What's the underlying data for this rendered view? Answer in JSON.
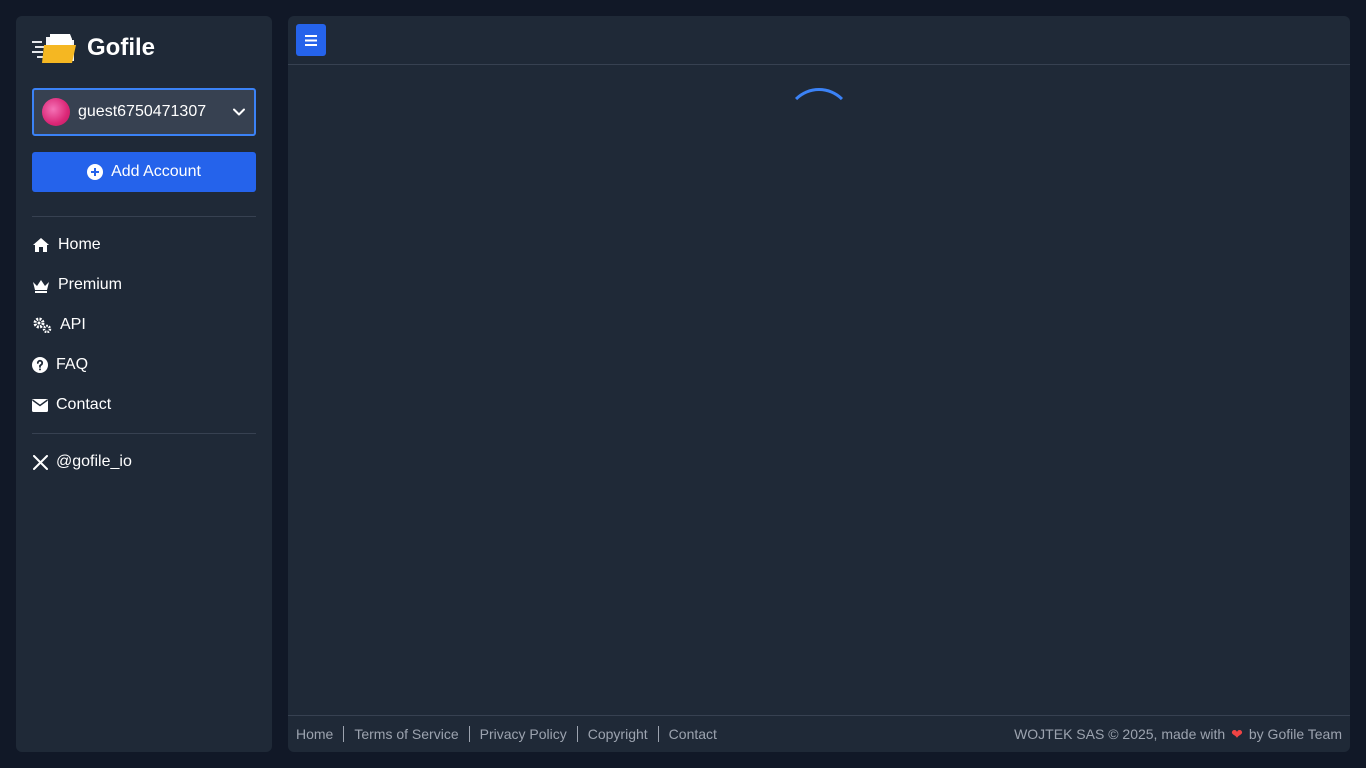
{
  "brand": {
    "name": "Gofile",
    "logo_icon": "folder-logo-icon"
  },
  "account": {
    "username": "guest6750471307"
  },
  "add_account_label": "Add Account",
  "nav": [
    {
      "label": "Home",
      "icon": "home-icon"
    },
    {
      "label": "Premium",
      "icon": "crown-icon"
    },
    {
      "label": "API",
      "icon": "gears-icon"
    },
    {
      "label": "FAQ",
      "icon": "question-icon"
    },
    {
      "label": "Contact",
      "icon": "envelope-icon"
    }
  ],
  "social": {
    "label": "@gofile_io",
    "icon": "x-logo-icon"
  },
  "footer": {
    "links": [
      "Home",
      "Terms of Service",
      "Privacy Policy",
      "Copyright",
      "Contact"
    ],
    "copyright_prefix": "WOJTEK SAS © 2025, made with",
    "copyright_suffix": "by Gofile Team"
  },
  "colors": {
    "accent": "#2563eb",
    "background": "#111827",
    "panel": "#1f2937",
    "heart": "#ef4444"
  }
}
